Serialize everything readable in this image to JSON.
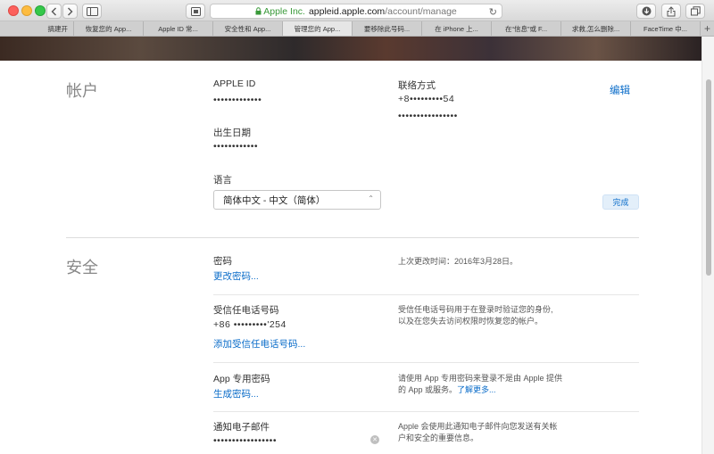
{
  "browser": {
    "url_secure_label": "Apple Inc.",
    "url_domain": "appleid.apple.com",
    "url_path": "/account/manage",
    "tabs": [
      "搞建开",
      "恢复您的 App...",
      "Apple ID 常...",
      "安全性和 App...",
      "管理您的 App...",
      "要移除此号码...",
      "在 iPhone 上...",
      "在“信息”或 F...",
      "求救,怎么删除...",
      "FaceTime 中..."
    ],
    "active_tab_index": 4,
    "new_tab_label": "+"
  },
  "account": {
    "title": "帐户",
    "edit_label": "编辑",
    "apple_id_label": "APPLE ID",
    "apple_id_value": "•••••••••••••",
    "contact_label": "联络方式",
    "contact_phone": "+8•••••••••54",
    "contact_email": "••••••••••••••••",
    "birthday_label": "出生日期",
    "birthday_value": "••••••••••••",
    "language_label": "语言",
    "language_selected": "简体中文 - 中文（简体）"
  },
  "security": {
    "title": "安全",
    "password_label": "密码",
    "password_change_link": "更改密码...",
    "password_last_changed": "上次更改时间：2016年3月28日。",
    "done_button": "完成",
    "trusted_phone_label": "受信任电话号码",
    "trusted_phone_value": "+86 •••••••••'254",
    "trusted_phone_add_link": "添加受信任电话号码...",
    "trusted_phone_desc_1": "受信任电话号码用于在登录时验证您的身份,",
    "trusted_phone_desc_2": "以及在您失去访问权限时恢复您的帐户。",
    "app_password_label": "App 专用密码",
    "app_password_link": "生成密码...",
    "app_password_desc_1": "请使用 App 专用密码来登录不是由 Apple 提供",
    "app_password_desc_2": "的 App 或服务。",
    "app_password_learn_more": "了解更多...",
    "notify_email_label": "通知电子邮件",
    "notify_email_value": "•••••••••••••••••",
    "notify_desc_1": "Apple 会使用此通知电子邮件向您发送有关帐",
    "notify_desc_2": "户和安全的重要信息。"
  },
  "colors": {
    "link": "#0a6cc9",
    "section_title": "#888888",
    "done_bg": "#e3effa"
  }
}
